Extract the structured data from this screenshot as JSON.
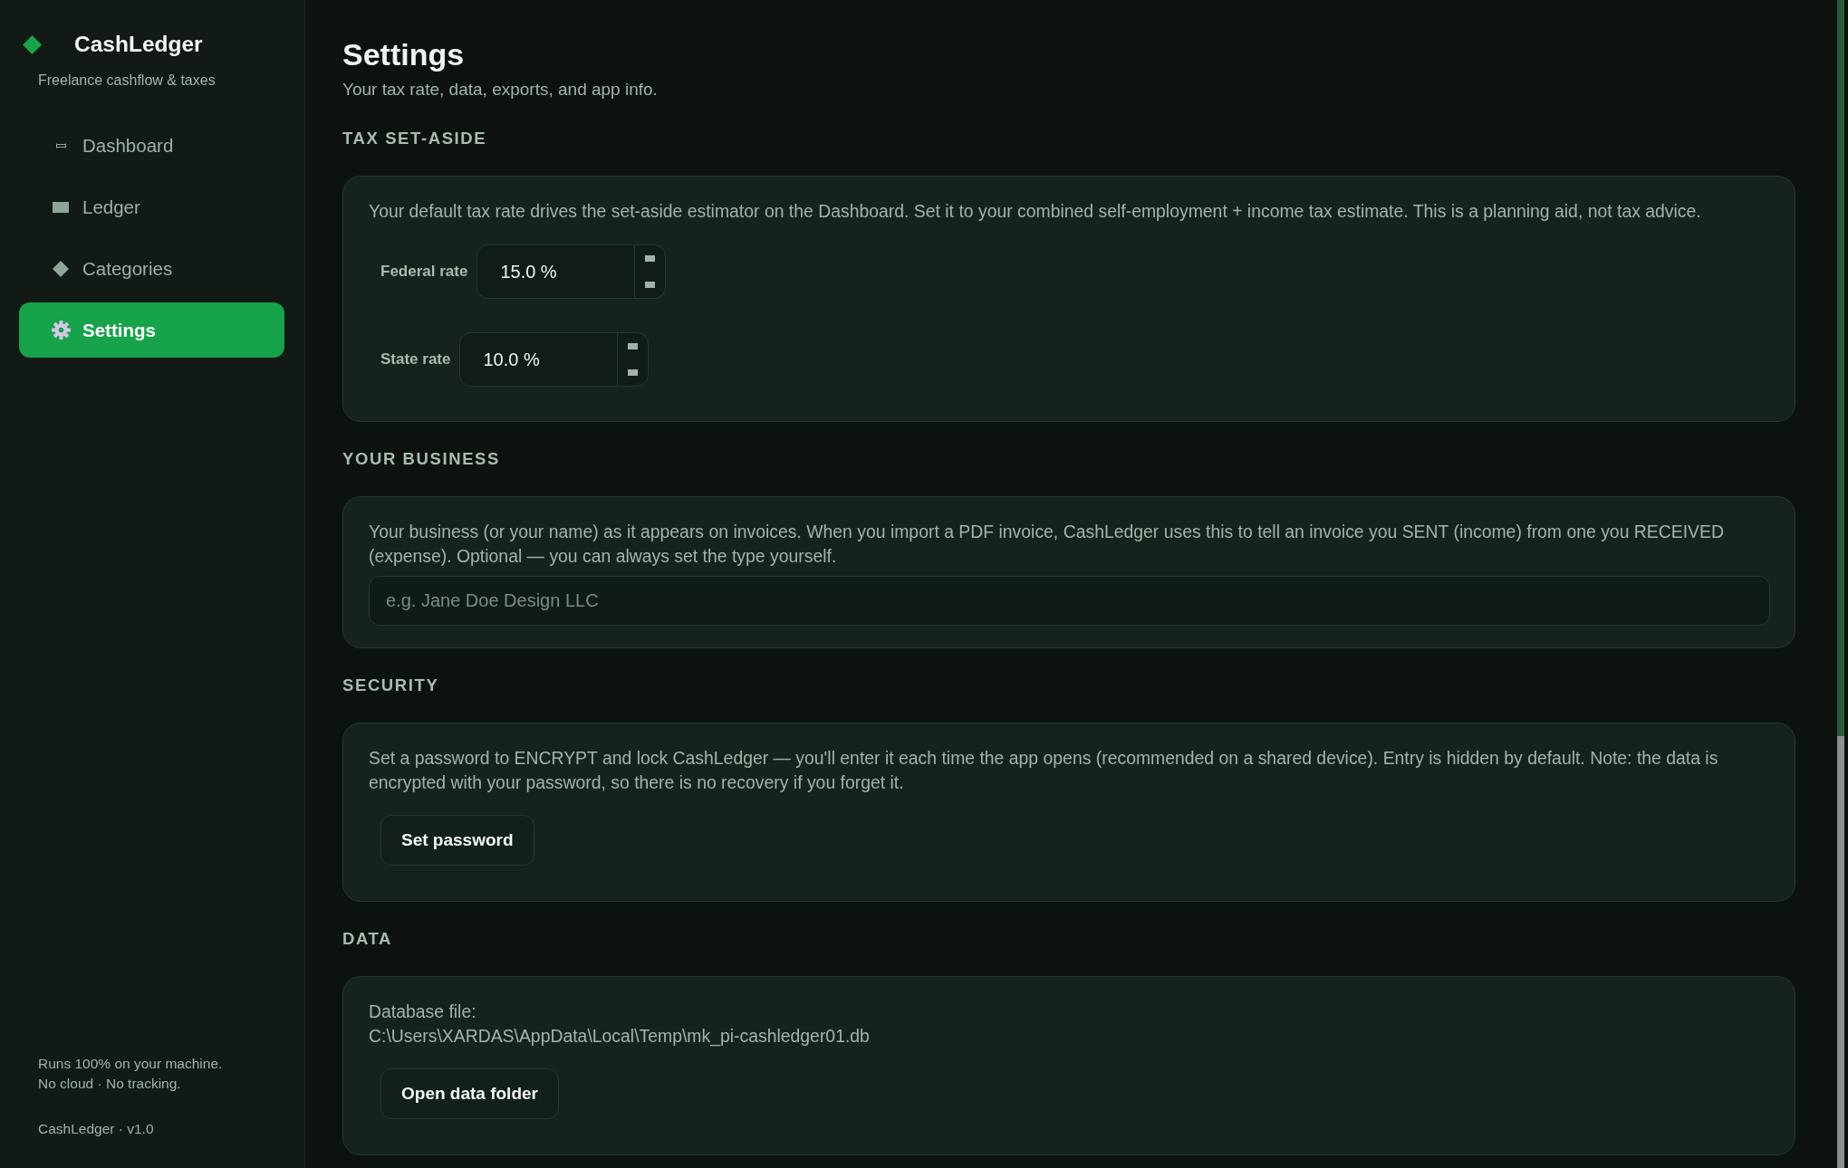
{
  "sidebar": {
    "brand": {
      "name": "CashLedger",
      "tagline": "Freelance cashflow & taxes"
    },
    "nav": [
      {
        "label": "Dashboard",
        "selected": false
      },
      {
        "label": "Ledger",
        "selected": false
      },
      {
        "label": "Categories",
        "selected": false
      },
      {
        "label": "Settings",
        "selected": true
      }
    ],
    "footer": {
      "note_lines": [
        "Runs 100% on your machine.",
        "No cloud · No tracking."
      ],
      "version": "CashLedger · v1.0"
    }
  },
  "page": {
    "title": "Settings",
    "subtitle": "Your tax rate, data, exports, and app info."
  },
  "sections": [
    {
      "kind": "rates",
      "heading": "TAX SET-ASIDE",
      "description": "Your default tax rate drives the set-aside estimator on the Dashboard. Set it to your combined self-employment + income tax estimate. This is a planning aid, not tax advice.",
      "fields": [
        {
          "label": "Federal rate",
          "value": "15.0 %"
        },
        {
          "label": "State rate",
          "value": "10.0 %"
        }
      ]
    },
    {
      "kind": "text_input",
      "heading": "YOUR BUSINESS",
      "description": "Your business (or your name) as it appears on invoices. When you import a PDF invoice, CashLedger uses this to tell an invoice you SENT (income) from one you RECEIVED (expense). Optional — you can always set the type yourself.",
      "input": {
        "placeholder": "e.g. Jane Doe Design LLC"
      }
    },
    {
      "kind": "action",
      "heading": "SECURITY",
      "description": "Set a password to ENCRYPT and lock CashLedger — you'll enter it each time the app opens (recommended on a shared device). Entry is hidden by default. Note: the data is encrypted with your password, so there is no recovery if you forget it.",
      "button": "Set password"
    },
    {
      "kind": "file",
      "heading": "DATA",
      "label": "Database file:",
      "path": "C:\\Users\\XARDAS\\AppData\\Local\\Temp\\mk_pi-cashledger01.db",
      "button": "Open data folder"
    }
  ]
}
